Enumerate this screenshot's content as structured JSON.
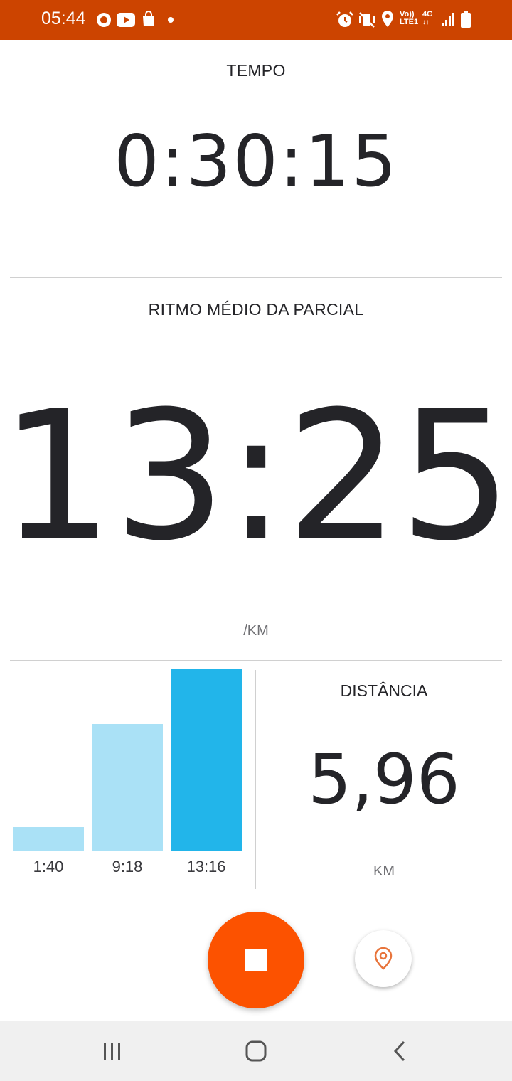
{
  "status_bar": {
    "time": "05:44",
    "background": "#cc4400",
    "left_icons": [
      "record-icon",
      "youtube-icon",
      "shopping-bag-icon",
      "dot-icon"
    ],
    "right_icons": [
      "alarm-icon",
      "vibrate-icon",
      "location-icon",
      "volte-icon",
      "4g-icon",
      "signal-icon",
      "battery-icon"
    ],
    "volte_text": "Vo))",
    "lte_text": "LTE1",
    "network_text": "4G"
  },
  "time": {
    "label": "TEMPO",
    "value": "0:30:15"
  },
  "pace": {
    "label": "RITMO MÉDIO DA PARCIAL",
    "value": "13:25",
    "unit": "/KM"
  },
  "splits": {
    "items": [
      {
        "label": "1:40",
        "level": 0.127,
        "color": "#aae1f6"
      },
      {
        "label": "9:18",
        "level": 0.695,
        "color": "#aae1f6"
      },
      {
        "label": "13:16",
        "level": 1.0,
        "color": "#22b5ea"
      }
    ]
  },
  "distance": {
    "label": "DISTÂNCIA",
    "value": "5,96",
    "unit": "KM"
  },
  "controls": {
    "stop_icon": "stop-icon",
    "stop_color": "#fc5200",
    "location_icon": "location-pin-icon"
  },
  "nav_bar": {
    "recents_icon": "recents-icon",
    "home_icon": "home-icon",
    "back_icon": "back-icon"
  }
}
